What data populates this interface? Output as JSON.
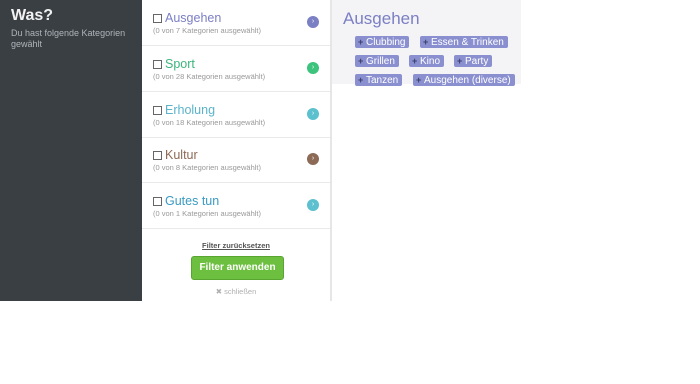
{
  "sidebar": {
    "title": "Was?",
    "subtitle": "Du hast folgende Kategorien gewählt"
  },
  "categories": [
    {
      "name": "Ausgehen",
      "count": "(0 von 7 Kategorien ausgewählt)",
      "color": "#7b7fc4",
      "dot": "#7b7fc4"
    },
    {
      "name": "Sport",
      "count": "(0 von 28 Kategorien ausgewählt)",
      "color": "#3cb57a",
      "dot": "#3cc37c"
    },
    {
      "name": "Erholung",
      "count": "(0 von 18 Kategorien ausgewählt)",
      "color": "#5ab3c8",
      "dot": "#5cc0cf"
    },
    {
      "name": "Kultur",
      "count": "(0 von 8 Kategorien ausgewählt)",
      "color": "#8c6a55",
      "dot": "#8c6a55"
    },
    {
      "name": "Gutes tun",
      "count": "(0 von 1 Kategorien ausgewählt)",
      "color": "#3a9ac2",
      "dot": "#5cc0cf"
    }
  ],
  "actions": {
    "reset": "Filter zurücksetzen",
    "apply": "Filter anwenden",
    "close": "schließen"
  },
  "detail": {
    "heading": "Ausgehen",
    "tags": [
      "Clubbing",
      "Essen & Trinken",
      "Grillen",
      "Kino",
      "Party",
      "Tanzen",
      "Ausgehen (diverse)"
    ]
  },
  "icons": {
    "checkbox": "checkbox-icon",
    "arrow": "chevron-right-icon",
    "close": "close-icon",
    "plus": "plus-icon"
  }
}
